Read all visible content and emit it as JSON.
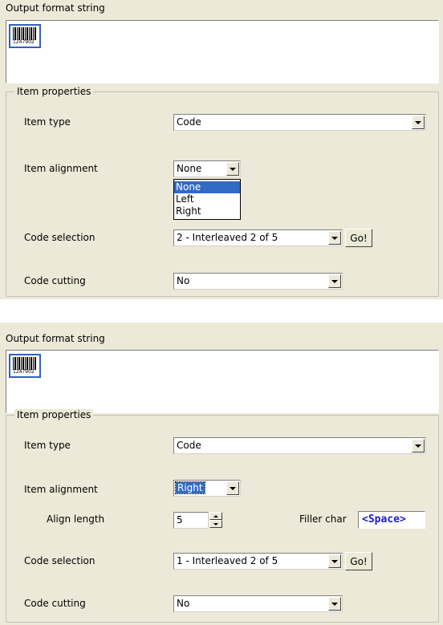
{
  "panel_a": {
    "output_label": "Output format string",
    "barcode_digits": "1247902",
    "group_label": "Item properties",
    "item_type": {
      "label": "Item type",
      "value": "Code"
    },
    "item_alignment": {
      "label": "Item alignment",
      "value": "None",
      "options": [
        {
          "label": "None"
        },
        {
          "label": "Left"
        },
        {
          "label": "Right"
        }
      ],
      "highlighted": "None"
    },
    "code_selection": {
      "label": "Code selection",
      "value": "2 - Interleaved 2 of 5",
      "go": "Go!"
    },
    "code_cutting": {
      "label": "Code cutting",
      "value": "No"
    }
  },
  "panel_b": {
    "output_label": "Output format string",
    "barcode_digits": "1247902",
    "group_label": "Item properties",
    "item_type": {
      "label": "Item type",
      "value": "Code"
    },
    "item_alignment": {
      "label": "Item alignment",
      "value": "Right"
    },
    "align_length": {
      "label": "Align length",
      "value": "5"
    },
    "filler_char": {
      "label": "Filler char",
      "value": "<Space>"
    },
    "code_selection": {
      "label": "Code selection",
      "value": "1 - Interleaved 2 of 5",
      "go": "Go!"
    },
    "code_cutting": {
      "label": "Code cutting",
      "value": "No"
    }
  },
  "colors": {
    "panel_bg": "#ece9d8",
    "selection": "#316ac5",
    "filler_text": "#1a1ad0",
    "barcode_frame": "#2f62b8"
  }
}
